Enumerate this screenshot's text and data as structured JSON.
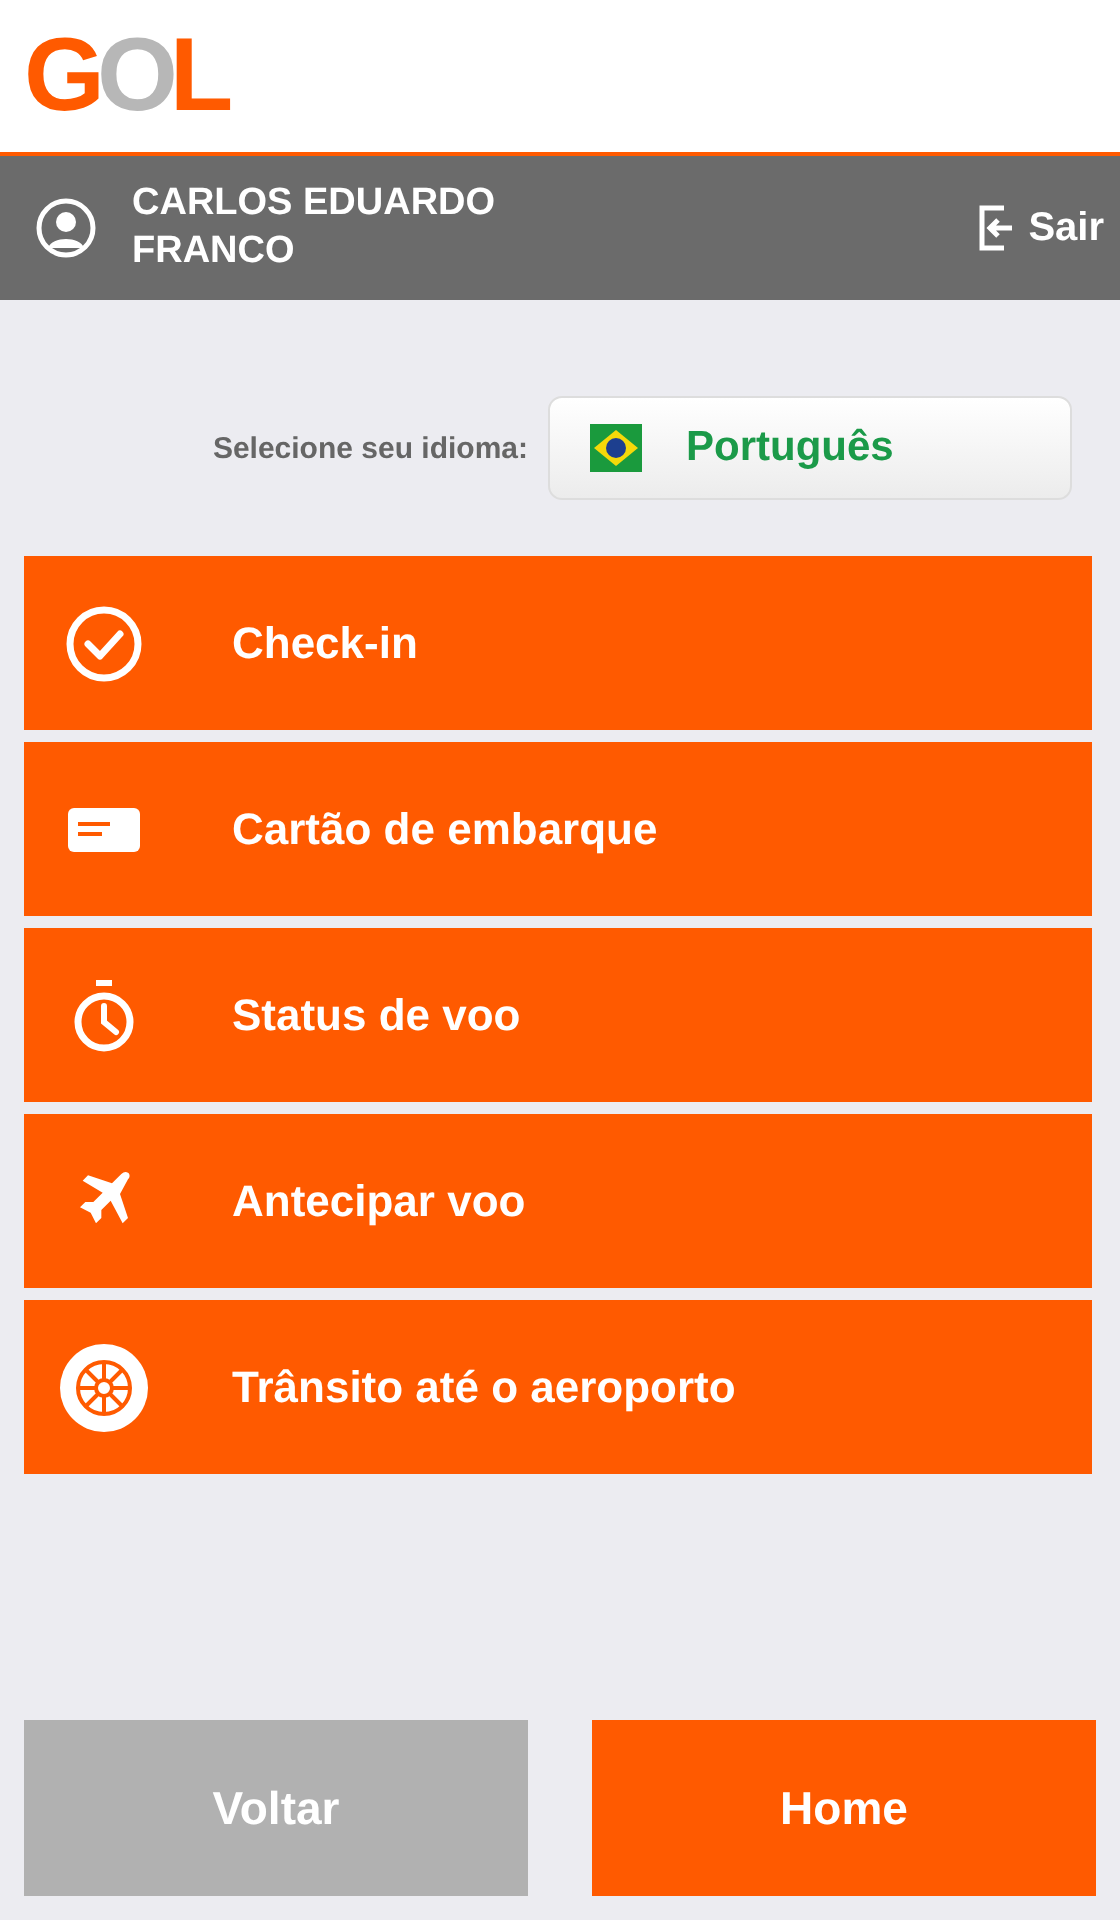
{
  "logo": "GOL",
  "user_bar": {
    "name": "CARLOS EDUARDO FRANCO",
    "logout": "Sair"
  },
  "language": {
    "label": "Selecione seu idioma:",
    "value": "Português"
  },
  "menu": [
    {
      "kind": "checkin",
      "label": "Check-in"
    },
    {
      "kind": "card",
      "label": "Cartão de embarque"
    },
    {
      "kind": "timer",
      "label": "Status de voo"
    },
    {
      "kind": "plane",
      "label": "Antecipar voo"
    },
    {
      "kind": "wheel",
      "label": "Trânsito até o aeroporto"
    }
  ],
  "buttons": [
    {
      "kind": "back",
      "label": "Voltar"
    },
    {
      "kind": "primary",
      "label": "Home"
    }
  ]
}
